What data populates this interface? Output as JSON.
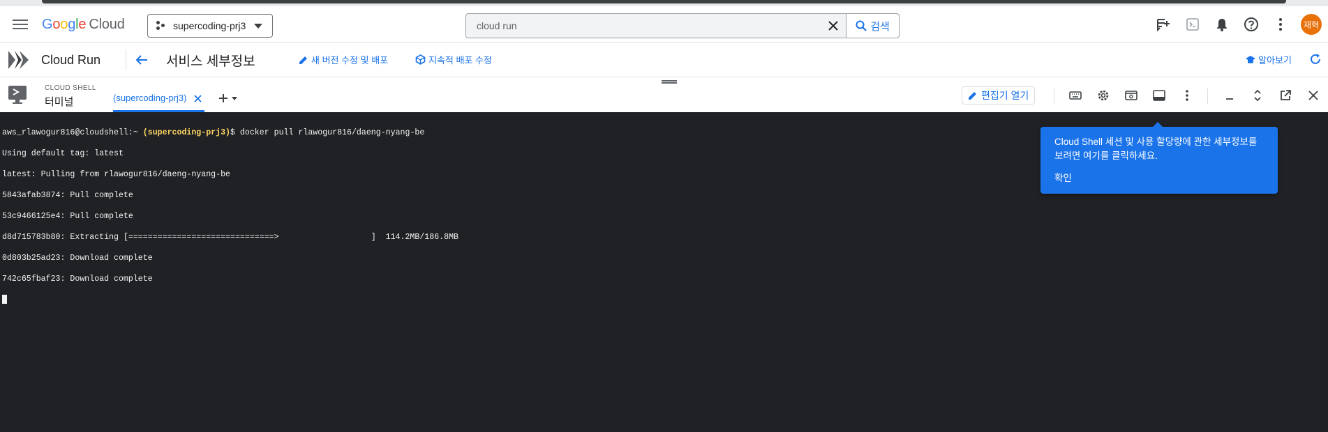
{
  "header": {
    "logo_parts": [
      "G",
      "o",
      "o",
      "g",
      "l",
      "e"
    ],
    "logo_product": "Cloud",
    "project_name": "supercoding-prj3",
    "search_value": "cloud run",
    "search_button": "검색",
    "avatar_initials": "재혁"
  },
  "subbar": {
    "product_name": "Cloud Run",
    "page_title": "서비스 세부정보",
    "actions": [
      "새 버전 수정 및 배포",
      "지속적 배포 수정"
    ],
    "learn_label": "알아보기"
  },
  "shell": {
    "label": "CLOUD SHELL",
    "sublabel": "터미널",
    "tab_label": "(supercoding-prj3)",
    "editor_button": "편집기 열기"
  },
  "terminal": {
    "prompt_user": "aws_rlawogur816@cloudshell:~",
    "prompt_project": "(supercoding-prj3)",
    "prompt_command": "$ docker pull rlawogur816/daeng-nyang-be",
    "lines": [
      "Using default tag: latest",
      "latest: Pulling from rlawogur816/daeng-nyang-be",
      "5843afab3874: Pull complete",
      "53c9466125e4: Pull complete",
      "d8d715783b80: Extracting [==============================>                   ]  114.2MB/186.8MB",
      "0d803b25ad23: Download complete",
      "742c65fbaf23: Download complete"
    ]
  },
  "tooltip": {
    "message": "Cloud Shell 세션 및 사용 할당량에 관한 세부정보를 보려면 여기를 클릭하세요.",
    "confirm": "확인"
  },
  "colors": {
    "accent": "#1a73e8",
    "terminal_bg": "#202124",
    "prompt_project": "#fdd663",
    "avatar": "#e8710a"
  }
}
